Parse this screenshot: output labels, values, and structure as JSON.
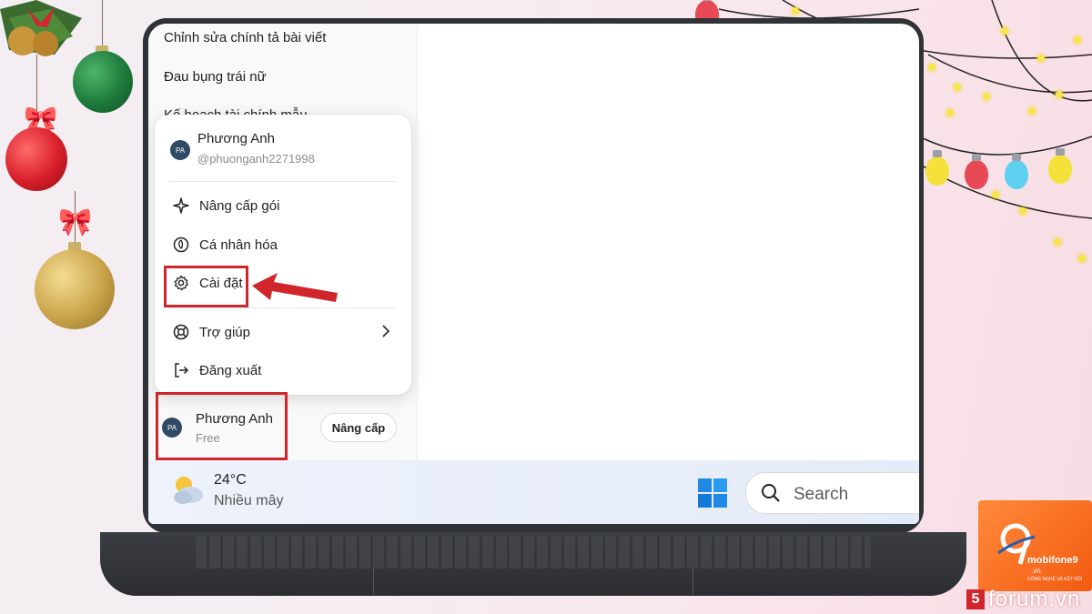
{
  "history": {
    "items": [
      "Chỉnh sửa chính tả bài viết",
      "Đau bụng trái nữ",
      "Kế hoạch tài chính mẫu"
    ]
  },
  "profile_menu": {
    "avatar_initials": "PA",
    "name": "Phương Anh",
    "handle": "@phuonganh2271998",
    "items": [
      {
        "label": "Nâng cấp gói",
        "icon": "sparkle-icon"
      },
      {
        "label": "Cá nhân hóa",
        "icon": "personalize-icon"
      },
      {
        "label": "Cài đặt",
        "icon": "gear-icon",
        "highlighted": true
      },
      {
        "label": "Trợ giúp",
        "icon": "lifebuoy-icon",
        "has_submenu": true
      },
      {
        "label": "Đăng xuất",
        "icon": "logout-icon"
      }
    ]
  },
  "account": {
    "avatar_initials": "PA",
    "name": "Phương Anh",
    "plan": "Free",
    "upgrade_label": "Nâng cấp"
  },
  "taskbar": {
    "weather_temp": "24°C",
    "weather_condition": "Nhiều mây",
    "search_label": "Search"
  },
  "branding": {
    "logo_name": "mobifone9",
    "logo_tld": ".vn",
    "logo_tagline": "CÔNG NGHỆ VÀ KẾT NỐI",
    "watermark": "forum.vn",
    "watermark_box": "5"
  },
  "colors": {
    "highlight": "#d0262b",
    "avatar": "#2f4a64",
    "brand": "#f25a11"
  }
}
